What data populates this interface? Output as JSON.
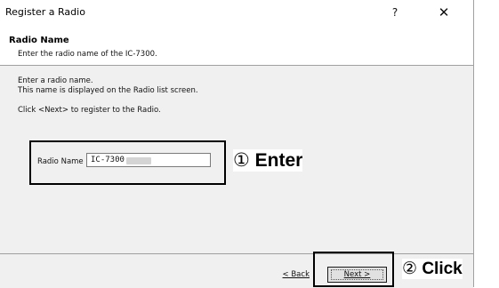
{
  "window": {
    "title": "Register a Radio",
    "help_glyph": "?",
    "close_glyph": "✕"
  },
  "header": {
    "title": "Radio Name",
    "subtitle": "Enter the radio name of the IC-7300."
  },
  "body": {
    "instruction_line_1": "Enter a radio name.",
    "instruction_line_2": "This name is displayed on the Radio list screen.",
    "instruction_line_3": "Click <Next> to register to the Radio.",
    "field_label": "Radio Name",
    "field_value": "IC-7300"
  },
  "footer": {
    "back_label": "< Back",
    "next_label": "Next >"
  },
  "annotations": {
    "enter_number": "①",
    "enter_text": "Enter",
    "click_number": "②",
    "click_text": "Click"
  }
}
